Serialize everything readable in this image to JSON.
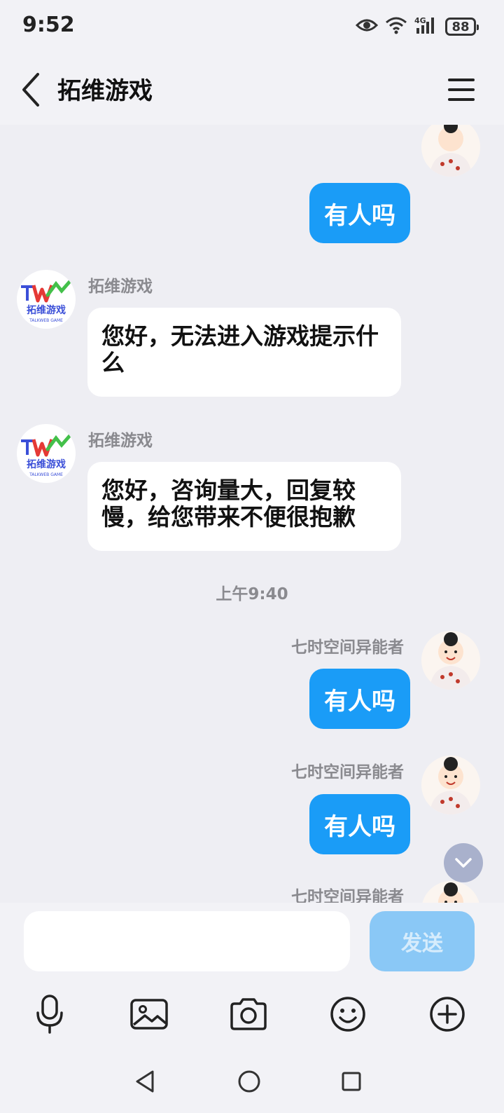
{
  "status_bar": {
    "time": "9:52",
    "battery": "88",
    "network": "4G"
  },
  "header": {
    "title": "拓维游戏"
  },
  "colors": {
    "accent": "#1a9cf7",
    "send_disabled": "#8ac8f6",
    "background": "#eeeef3"
  },
  "messages": [
    {
      "side": "right",
      "sender": "",
      "text": "有人吗"
    },
    {
      "side": "left",
      "sender": "拓维游戏",
      "text": "您好，无法进入游戏提示什么"
    },
    {
      "side": "left",
      "sender": "拓维游戏",
      "text": "您好，咨询量大，回复较慢，给您带来不便很抱歉"
    },
    {
      "type": "time",
      "text": "上午9:40"
    },
    {
      "side": "right",
      "sender": "七时空间异能者",
      "text": "有人吗"
    },
    {
      "side": "right",
      "sender": "七时空间异能者",
      "text": "有人吗"
    },
    {
      "side": "right",
      "sender": "七时空间异能者",
      "text": ""
    }
  ],
  "brand_avatar": {
    "logo_text": "拓维游戏",
    "sub_text": "TALKWEB GAME"
  },
  "input": {
    "placeholder": "",
    "value": ""
  },
  "send_button": {
    "label": "发送"
  },
  "toolbar_icons": [
    "microphone-icon",
    "image-icon",
    "camera-icon",
    "emoji-icon",
    "plus-icon"
  ],
  "nav_icons": [
    "back-triangle-icon",
    "home-circle-icon",
    "recents-square-icon"
  ]
}
